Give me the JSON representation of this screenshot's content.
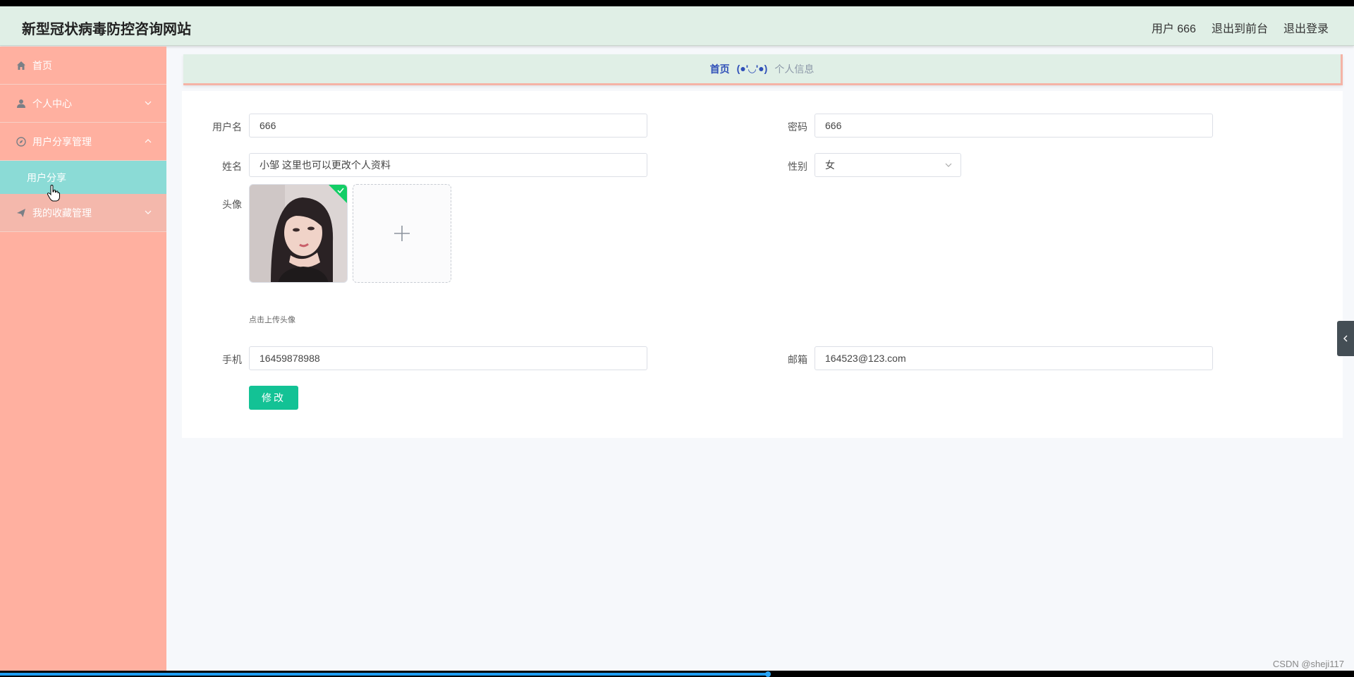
{
  "header": {
    "title": "新型冠状病毒防控咨询网站",
    "user": "用户 666",
    "back_front": "退出到前台",
    "logout": "退出登录"
  },
  "sidebar": {
    "items": [
      {
        "label": "首页",
        "icon": "home-icon"
      },
      {
        "label": "个人中心",
        "icon": "user-icon"
      },
      {
        "label": "用户分享管理",
        "icon": "compass-icon"
      },
      {
        "label": "用户分享",
        "icon": ""
      },
      {
        "label": "我的收藏管理",
        "icon": "send-icon"
      }
    ]
  },
  "breadcrumb": {
    "home": "首页",
    "separator": "(●'◡'●)",
    "current": "个人信息"
  },
  "form": {
    "username_label": "用户名",
    "username": "666",
    "password_label": "密码",
    "password": "666",
    "name_label": "姓名",
    "name": "小邹 这里也可以更改个人资料",
    "gender_label": "性别",
    "gender": "女",
    "avatar_label": "头像",
    "upload_tip": "点击上传头像",
    "phone_label": "手机",
    "phone": "16459878988",
    "email_label": "邮箱",
    "email": "164523@123.com",
    "submit": "修改"
  },
  "video": {
    "progress": 0.567
  },
  "watermark": "CSDN @sheji117",
  "colors": {
    "sidebar_bg": "#ffb0a0",
    "active_item": "#8bdbd6",
    "header_bg": "#e0efe6",
    "submit_bg": "#13c295"
  }
}
